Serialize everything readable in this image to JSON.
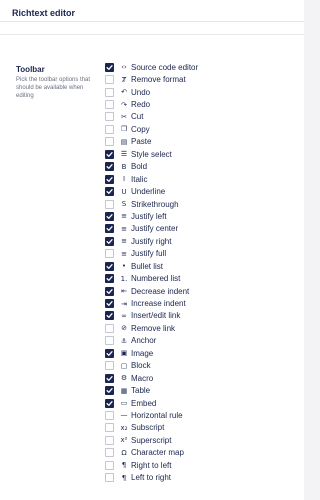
{
  "header": {
    "title": "Richtext editor"
  },
  "toolbar_setting": {
    "label": "Toolbar",
    "description": "Pick the toolbar options that should be available when editing"
  },
  "options": [
    {
      "label": "Source code editor",
      "icon": "code-icon",
      "glyph": "‹›",
      "checked": true
    },
    {
      "label": "Remove format",
      "icon": "clear-format-icon",
      "glyph": "Ⱦ",
      "checked": false
    },
    {
      "label": "Undo",
      "icon": "undo-icon",
      "glyph": "↶",
      "checked": false
    },
    {
      "label": "Redo",
      "icon": "redo-icon",
      "glyph": "↷",
      "checked": false
    },
    {
      "label": "Cut",
      "icon": "scissors-icon",
      "glyph": "✂",
      "checked": false
    },
    {
      "label": "Copy",
      "icon": "copy-icon",
      "glyph": "❐",
      "checked": false
    },
    {
      "label": "Paste",
      "icon": "paste-icon",
      "glyph": "▤",
      "checked": false
    },
    {
      "label": "Style select",
      "icon": "style-select-icon",
      "glyph": "☰",
      "checked": true
    },
    {
      "label": "Bold",
      "icon": "bold-icon",
      "glyph": "B",
      "checked": true
    },
    {
      "label": "Italic",
      "icon": "italic-icon",
      "glyph": "I",
      "checked": true
    },
    {
      "label": "Underline",
      "icon": "underline-icon",
      "glyph": "U",
      "checked": true
    },
    {
      "label": "Strikethrough",
      "icon": "strikethrough-icon",
      "glyph": "S",
      "checked": false
    },
    {
      "label": "Justify left",
      "icon": "align-left-icon",
      "glyph": "≡",
      "checked": true
    },
    {
      "label": "Justify center",
      "icon": "align-center-icon",
      "glyph": "≡",
      "checked": true
    },
    {
      "label": "Justify right",
      "icon": "align-right-icon",
      "glyph": "≡",
      "checked": true
    },
    {
      "label": "Justify full",
      "icon": "align-justify-icon",
      "glyph": "≡",
      "checked": false
    },
    {
      "label": "Bullet list",
      "icon": "bullet-list-icon",
      "glyph": "•",
      "checked": true
    },
    {
      "label": "Numbered list",
      "icon": "numbered-list-icon",
      "glyph": "1.",
      "checked": true
    },
    {
      "label": "Decrease indent",
      "icon": "outdent-icon",
      "glyph": "⇤",
      "checked": true
    },
    {
      "label": "Increase indent",
      "icon": "indent-icon",
      "glyph": "⇥",
      "checked": true
    },
    {
      "label": "Insert/edit link",
      "icon": "link-icon",
      "glyph": "∞",
      "checked": true
    },
    {
      "label": "Remove link",
      "icon": "unlink-icon",
      "glyph": "⊘",
      "checked": false
    },
    {
      "label": "Anchor",
      "icon": "anchor-icon",
      "glyph": "⚓",
      "checked": false
    },
    {
      "label": "Image",
      "icon": "image-icon",
      "glyph": "▣",
      "checked": true
    },
    {
      "label": "Block",
      "icon": "block-icon",
      "glyph": "▢",
      "checked": false
    },
    {
      "label": "Macro",
      "icon": "macro-icon",
      "glyph": "⚙",
      "checked": true
    },
    {
      "label": "Table",
      "icon": "table-icon",
      "glyph": "▦",
      "checked": true
    },
    {
      "label": "Embed",
      "icon": "embed-icon",
      "glyph": "▭",
      "checked": true
    },
    {
      "label": "Horizontal rule",
      "icon": "horizontal-rule-icon",
      "glyph": "—",
      "checked": false
    },
    {
      "label": "Subscript",
      "icon": "subscript-icon",
      "glyph": "x₂",
      "checked": false
    },
    {
      "label": "Superscript",
      "icon": "superscript-icon",
      "glyph": "x²",
      "checked": false
    },
    {
      "label": "Character map",
      "icon": "omega-icon",
      "glyph": "Ω",
      "checked": false
    },
    {
      "label": "Right to left",
      "icon": "rtl-icon",
      "glyph": "¶",
      "checked": false
    },
    {
      "label": "Left to right",
      "icon": "ltr-icon",
      "glyph": "¶",
      "checked": false
    }
  ]
}
